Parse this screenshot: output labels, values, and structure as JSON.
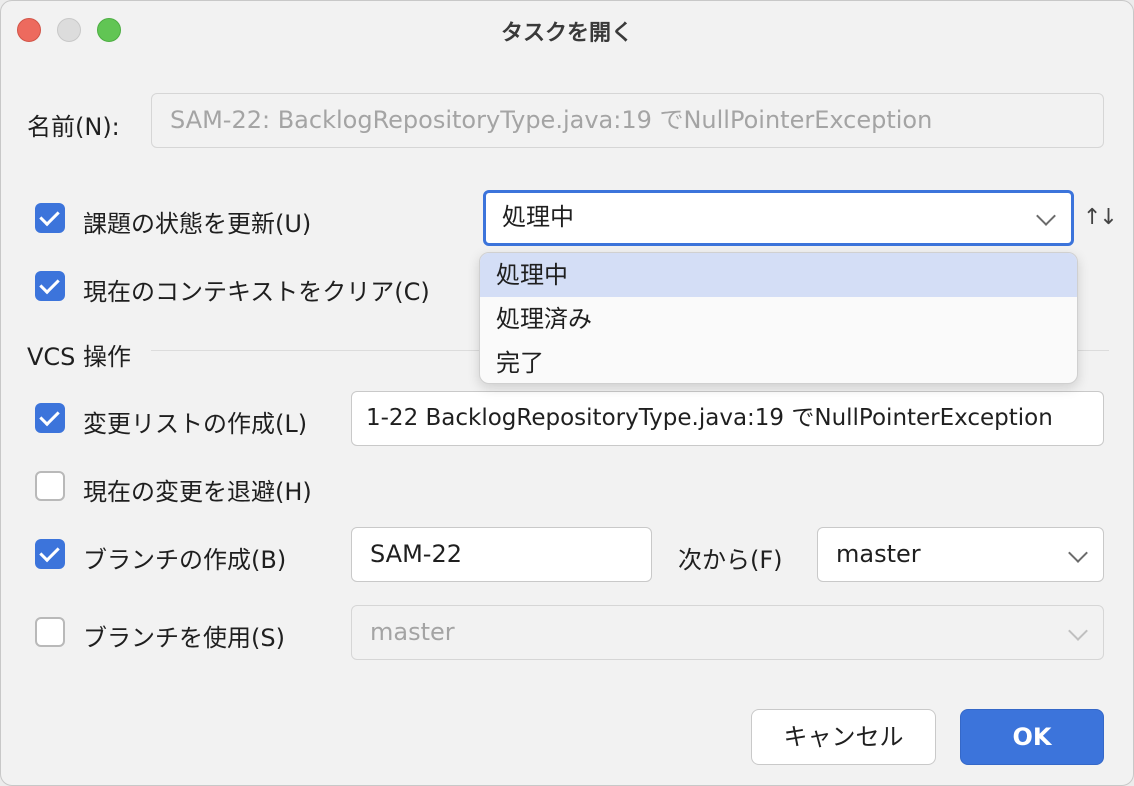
{
  "window": {
    "title": "タスクを開く"
  },
  "name_field": {
    "label": "名前(N):",
    "value": "SAM-22: BacklogRepositoryType.java:19 でNullPointerException"
  },
  "update_state": {
    "label": "課題の状態を更新(U)",
    "checked": true,
    "selected": "処理中"
  },
  "clear_context": {
    "label": "現在のコンテキストをクリア(C)",
    "checked": true
  },
  "state_dropdown": {
    "options": [
      "処理中",
      "処理済み",
      "完了"
    ],
    "highlighted": "処理中"
  },
  "vcs_section": {
    "title": "VCS 操作"
  },
  "changelist": {
    "label": "変更リストの作成(L)",
    "checked": true,
    "value": "1-22 BacklogRepositoryType.java:19 でNullPointerException"
  },
  "shelve": {
    "label": "現在の変更を退避(H)",
    "checked": false
  },
  "create_branch": {
    "label": "ブランチの作成(B)",
    "checked": true,
    "value": "SAM-22",
    "from_label": "次から(F)",
    "from_value": "master"
  },
  "use_branch": {
    "label": "ブランチを使用(S)",
    "checked": false,
    "value": "master"
  },
  "buttons": {
    "cancel": "キャンセル",
    "ok": "OK"
  },
  "colors": {
    "accent": "#3c74db",
    "selection": "#d4def6"
  },
  "icons": {
    "sort": "sort-arrows-icon",
    "chevron": "chevron-down-icon",
    "check": "checkmark-icon"
  }
}
